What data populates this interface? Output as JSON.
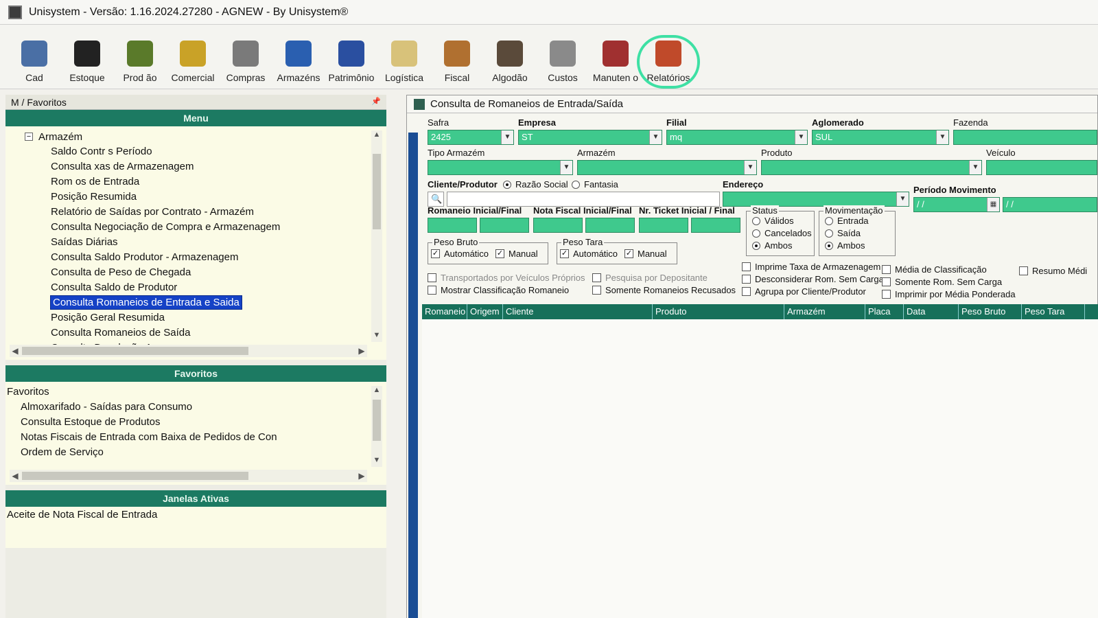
{
  "window": {
    "title": "Unisystem - Versão: 1.16.2024.27280 - AGNEW - By Unisystem®"
  },
  "toolbar": [
    {
      "label": "Cad",
      "icon": "contacts-icon"
    },
    {
      "label": "Estoque",
      "icon": "barcode-icon"
    },
    {
      "label": "Prod ão",
      "icon": "tractor-icon"
    },
    {
      "label": "Comercial",
      "icon": "money-icon"
    },
    {
      "label": "Compras",
      "icon": "pen-icon"
    },
    {
      "label": "Armazéns",
      "icon": "warehouse-icon"
    },
    {
      "label": "Patrimônio",
      "icon": "chair-icon"
    },
    {
      "label": "Logística",
      "icon": "truck-icon"
    },
    {
      "label": "Fiscal",
      "icon": "fiscal-icon"
    },
    {
      "label": "Algodão",
      "icon": "cotton-icon"
    },
    {
      "label": "Custos",
      "icon": "costs-icon"
    },
    {
      "label": "Manuten o",
      "icon": "tools-icon"
    },
    {
      "label": "Relatórios",
      "icon": "reports-icon"
    }
  ],
  "left": {
    "breadcrumb": "M / Favoritos",
    "menu_header": "Menu",
    "menu_root": "Armazém",
    "menu_items": [
      "Saldo Contr s Período",
      "Consulta xas de Armazenagem",
      "Rom os de Entrada",
      "Posição Resumida",
      "Relatório de Saídas por Contrato - Armazém",
      "Consulta Negociação de Compra e Armazenagem",
      "Saídas Diárias",
      "Consulta Saldo Produtor - Armazenagem",
      "Consulta de Peso de Chegada",
      "Consulta Saldo de Produtor",
      "Consulta Romaneios de Entrada e Saida",
      "Posição Geral Resumida",
      "Consulta Romaneios de Saída",
      "Consulta Devolução Armazenagem"
    ],
    "favorites_header": "Favoritos",
    "favorites_title": "Favoritos",
    "favorites": [
      "Almoxarifado - Saídas para Consumo",
      "Consulta Estoque de Produtos",
      "Notas Fiscais de Entrada com Baixa de Pedidos de Con",
      "Ordem de Serviço"
    ],
    "active_header": "Janelas Ativas",
    "active_windows": [
      "Aceite de Nota Fiscal de Entrada"
    ]
  },
  "form": {
    "title": "Consulta de Romaneios de Entrada/Saída",
    "labels": {
      "safra": "Safra",
      "empresa": "Empresa",
      "filial": "Filial",
      "aglomerado": "Aglomerado",
      "fazenda": "Fazenda",
      "tipo_armazem": "Tipo Armazém",
      "armazem": "Armazém",
      "produto": "Produto",
      "veiculo": "Veículo",
      "cliente_produtor": "Cliente/Produtor",
      "razao_social": "Razão Social",
      "fantasia": "Fantasia",
      "endereco": "Endereço",
      "periodo": "Período Movimento",
      "romaneio": "Romaneio Inicial/Final",
      "nota_fiscal": "Nota Fiscal Inicial/Final",
      "ticket": "Nr. Ticket Inicial / Final",
      "status": "Status",
      "movimentacao": "Movimentação",
      "peso_bruto": "Peso Bruto",
      "peso_tara": "Peso Tara"
    },
    "values": {
      "safra": "2425",
      "empresa": "ST",
      "filial": "mq",
      "aglomerado": "SUL",
      "date_from": "/ /",
      "date_to": "/ /"
    },
    "status_options": [
      "Válidos",
      "Cancelados",
      "Ambos"
    ],
    "mov_options": [
      "Entrada",
      "Saída",
      "Ambos"
    ],
    "peso_options": {
      "auto": "Automático",
      "manual": "Manual"
    },
    "checks": {
      "transportados": "Transportados por Veículos Próprios",
      "mostrar_class": "Mostrar Classificação Romaneio",
      "pesquisa_dep": "Pesquisa por Depositante",
      "somente_recusados": "Somente Romaneios Recusados",
      "imprime_taxa": "Imprime Taxa de Armazenagem",
      "desconsiderar": "Desconsiderar Rom. Sem Carga",
      "agrupa": "Agrupa por Cliente/Produtor",
      "media_class": "Média de Classificação",
      "somente_sem_carga": "Somente Rom. Sem Carga",
      "imprimir_media": "Imprimir por Média Ponderada",
      "resumo_media": "Resumo Médi"
    },
    "columns": [
      "Romaneio",
      "Origem",
      "Cliente",
      "Produto",
      "Armazém",
      "Placa",
      "Data",
      "Peso Bruto",
      "Peso Tara"
    ]
  }
}
